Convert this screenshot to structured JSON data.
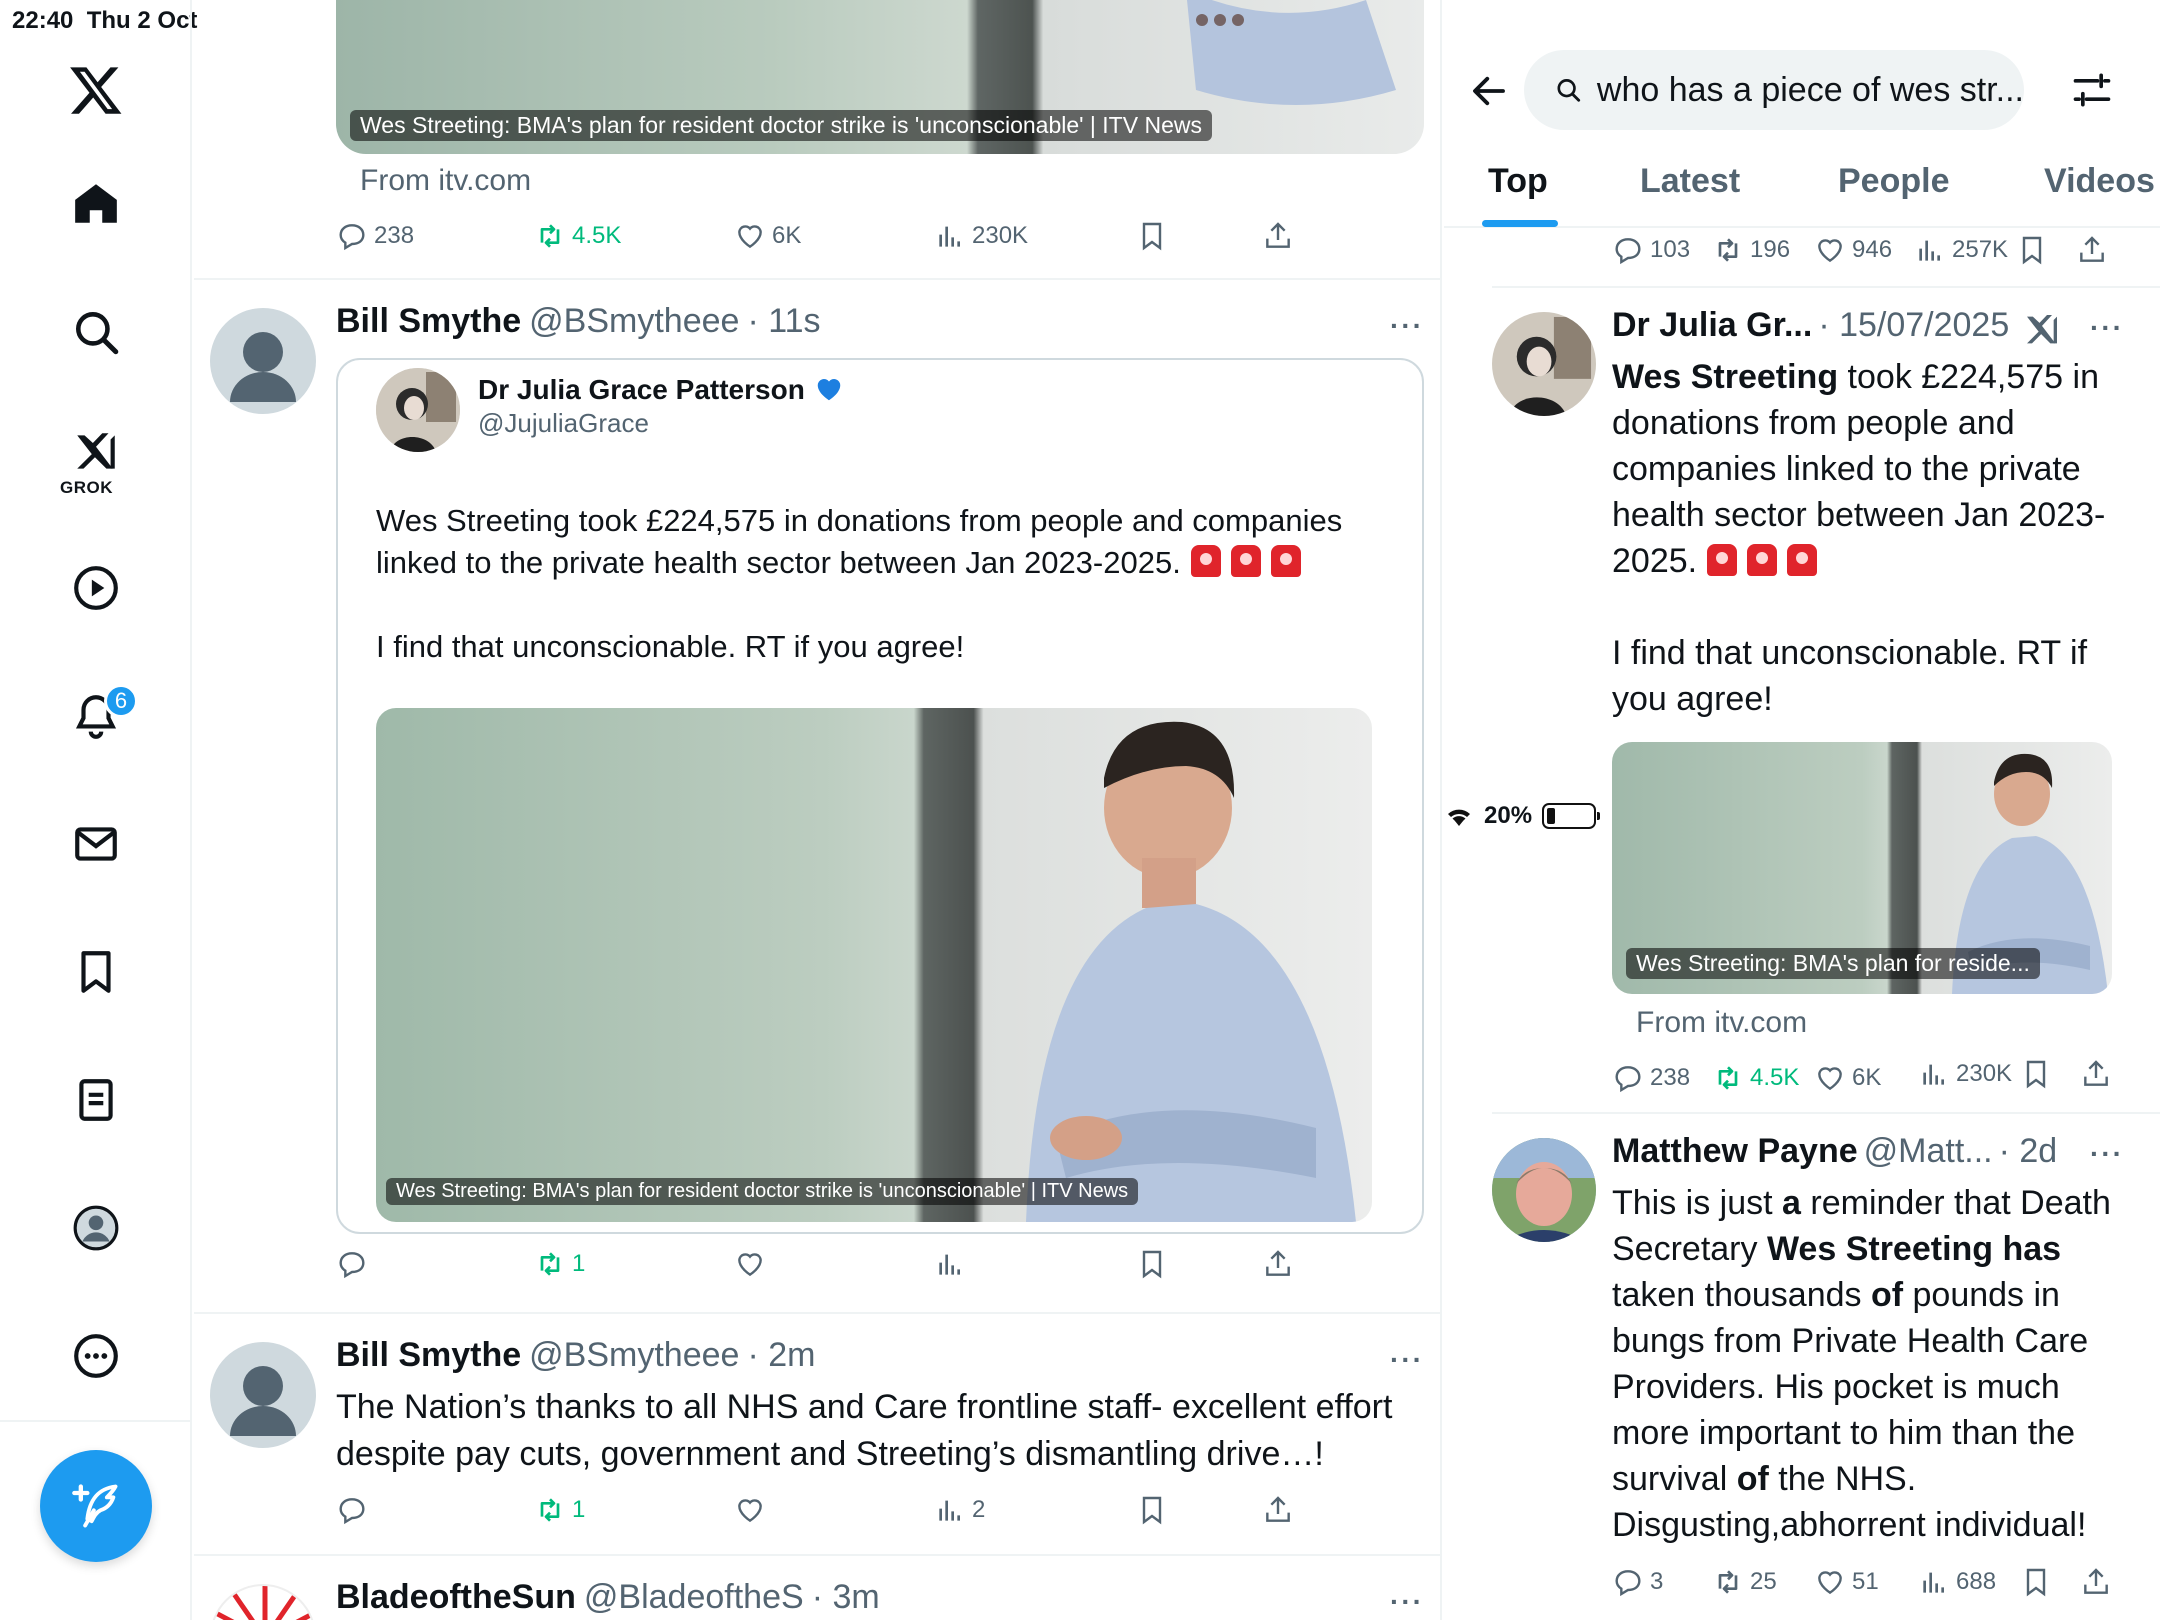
{
  "status_bar": {
    "time": "22:40",
    "date": "Thu 2 Oct",
    "battery": "20%"
  },
  "nav": {
    "grok_label": "GROK",
    "notifications_badge": "6",
    "icons": [
      "x-logo-icon",
      "home-icon",
      "search-icon",
      "grok-icon",
      "video-icon",
      "bell-icon",
      "mail-icon",
      "bookmark-icon",
      "list-icon",
      "profile-icon",
      "more-icon",
      "compose-icon"
    ]
  },
  "feed": {
    "top_card": {
      "caption": "Wes Streeting: BMA's plan for resident doctor strike is 'unconscionable' | ITV News",
      "from": "From itv.com",
      "replies": "238",
      "reposts": "4.5K",
      "likes": "6K",
      "views": "230K"
    },
    "tweet1": {
      "name": "Bill Smythe",
      "handle": "@BSmytheee",
      "time": "· 11s",
      "quote": {
        "name": "Dr Julia Grace Patterson",
        "handle": "@JujuliaGrace",
        "text1": "Wes Streeting took £224,575 in donations from people and companies linked to the private health sector between Jan 2023-2025.",
        "text2": "I find that unconscionable. RT if you agree!",
        "caption": "Wes Streeting: BMA's plan for resident doctor strike is 'unconscionable' | ITV News"
      },
      "reposts": "1"
    },
    "tweet2": {
      "name": "Bill Smythe",
      "handle": "@BSmytheee",
      "time": "· 2m",
      "text": "The Nation’s thanks to all NHS and Care frontline staff- excellent effort despite pay cuts, government and Streeting’s dismantling drive…!",
      "reposts": "1",
      "views": "2"
    },
    "tweet3": {
      "name": "BladeoftheSun",
      "handle": "@BladeoftheS",
      "time": "· 3m"
    }
  },
  "search": {
    "query": "who has a piece of wes str...",
    "tabs": [
      "Top",
      "Latest",
      "People",
      "Videos"
    ],
    "active_tab": "Top",
    "top_stats": {
      "replies": "103",
      "reposts": "196",
      "likes": "946",
      "views": "257K"
    },
    "result1": {
      "name": "Dr Julia Gr...",
      "time": "· 15/07/2025",
      "text_bold": "Wes Streeting",
      "text_rest": " took £224,575 in donations from people and companies linked to the private health sector between Jan 2023-2025.",
      "text2": "I find that unconscionable. RT if you agree!",
      "caption": "Wes Streeting: BMA's plan for reside...",
      "from": "From itv.com",
      "replies": "238",
      "reposts": "4.5K",
      "likes": "6K",
      "views": "230K"
    },
    "result2": {
      "name": "Matthew Payne",
      "handle": "@Matt...",
      "time": "· 2d",
      "stats": {
        "replies": "3",
        "reposts": "25",
        "likes": "51",
        "views": "688"
      }
    }
  },
  "colors": {
    "accent": "#1d9bf0",
    "repost": "#00ba7c",
    "muted": "#536471"
  }
}
